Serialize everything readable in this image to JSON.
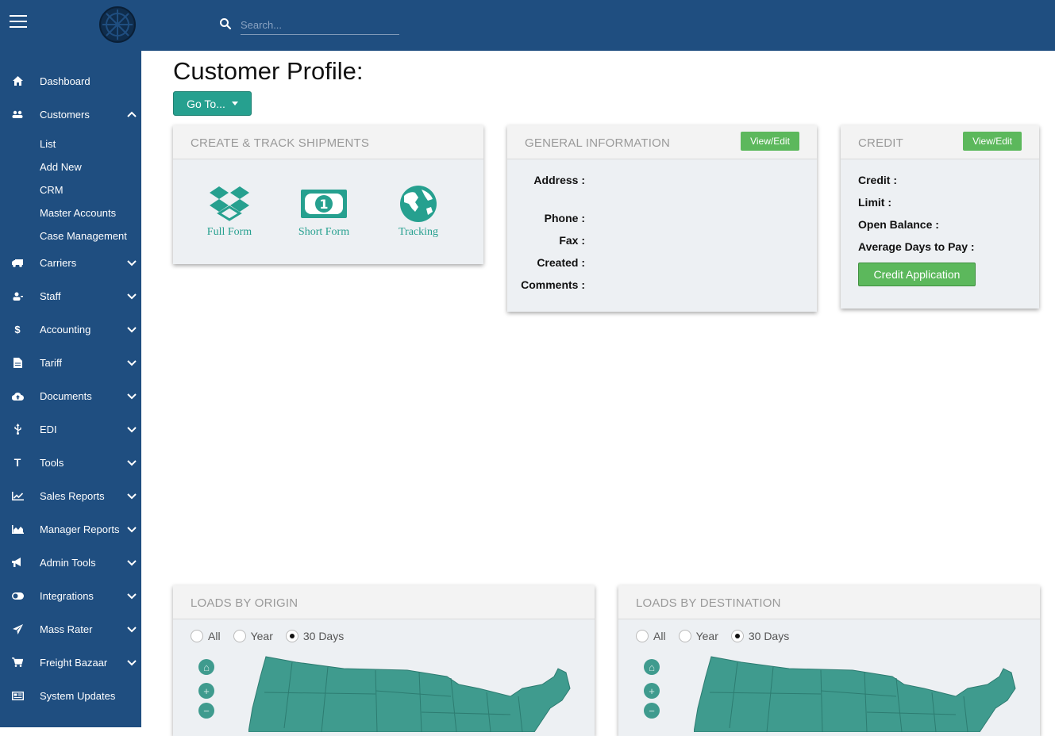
{
  "header": {
    "search_placeholder": "Search...",
    "icons": {
      "menu": "hamburger-icon",
      "search": "search-icon",
      "logo": "company-logo"
    },
    "color": "#1f4e80"
  },
  "sidebar": {
    "items": [
      {
        "label": "Dashboard",
        "icon": "home-icon"
      },
      {
        "label": "Customers",
        "icon": "users-icon",
        "expanded": true
      },
      {
        "label": "Carriers",
        "icon": "truck-icon"
      },
      {
        "label": "Staff",
        "icon": "user-group-icon"
      },
      {
        "label": "Accounting",
        "icon": "dollar-icon"
      },
      {
        "label": "Tariff",
        "icon": "file-icon"
      },
      {
        "label": "Documents",
        "icon": "cloud-upload-icon"
      },
      {
        "label": "EDI",
        "icon": "usb-icon"
      },
      {
        "label": "Tools",
        "icon": "text-t-icon"
      },
      {
        "label": "Sales Reports",
        "icon": "line-chart-icon"
      },
      {
        "label": "Manager Reports",
        "icon": "area-chart-icon"
      },
      {
        "label": "Admin Tools",
        "icon": "megaphone-icon"
      },
      {
        "label": "Integrations",
        "icon": "toggle-icon"
      },
      {
        "label": "Mass Rater",
        "icon": "paper-plane-icon"
      },
      {
        "label": "Freight Bazaar",
        "icon": "cart-icon"
      },
      {
        "label": "System Updates",
        "icon": "newspaper-icon"
      }
    ],
    "customers_sub": [
      "List",
      "Add New",
      "CRM",
      "Master Accounts",
      "Case Management"
    ]
  },
  "main": {
    "title": "Customer Profile:",
    "goto_label": "Go To..."
  },
  "shipments_card": {
    "title": "CREATE & TRACK SHIPMENTS",
    "links": [
      {
        "label": "Full Form",
        "icon": "dropbox-icon"
      },
      {
        "label": "Short Form",
        "icon": "money-bill-icon"
      },
      {
        "label": "Tracking",
        "icon": "globe-icon"
      }
    ],
    "accent": "#26a08f"
  },
  "general_card": {
    "title": "GENERAL INFORMATION",
    "edit_label": "View/Edit",
    "fields": [
      "Address :",
      "Phone :",
      "Fax :",
      "Created :",
      "Comments :"
    ]
  },
  "credit_card": {
    "title": "CREDIT",
    "edit_label": "View/Edit",
    "fields": [
      "Credit :",
      "Limit :",
      "Open Balance :",
      "Average Days to Pay :"
    ],
    "application_label": "Credit Application",
    "button_color": "#5cb85c"
  },
  "origin_card": {
    "title": "LOADS BY ORIGIN",
    "filters": [
      "All",
      "Year",
      "30 Days"
    ],
    "selected": "30 Days"
  },
  "destination_card": {
    "title": "LOADS BY DESTINATION",
    "filters": [
      "All",
      "Year",
      "30 Days"
    ],
    "selected": "30 Days"
  },
  "map_controls": [
    "home-icon",
    "zoom-in-icon",
    "zoom-out-icon"
  ],
  "map_color": "#3f9b8e"
}
